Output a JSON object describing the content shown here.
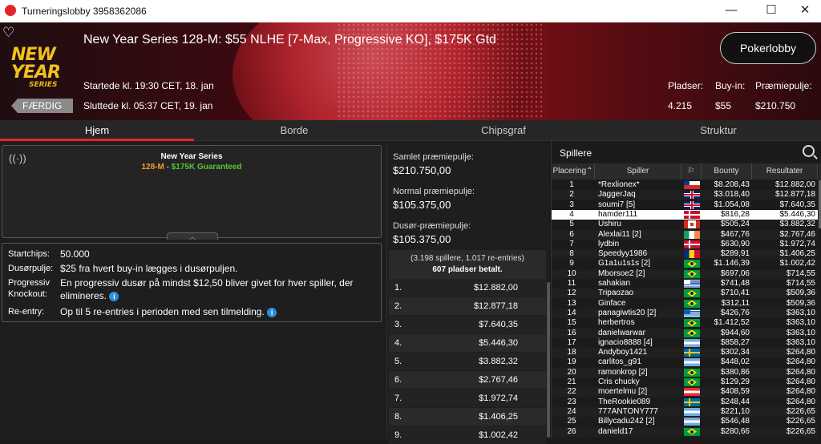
{
  "window": {
    "title": "Turneringslobby 3958362086",
    "minimize": "—",
    "maximize": "☐",
    "close": "✕"
  },
  "header": {
    "logo_line1": "NEW YEAR",
    "logo_line2": "SERIES",
    "status": "FÆRDIG",
    "title": "New Year Series 128-M: $55 NLHE [7-Max, Progressive KO], $175K Gtd",
    "started": "Startede kl. 19:30 CET, 18. jan",
    "ended": "Sluttede kl. 05:37 CET, 19. jan",
    "lobby_button": "Pokerlobby",
    "stats": [
      {
        "label": "Pladser:",
        "value": "4.215"
      },
      {
        "label": "Buy-in:",
        "value": "$55"
      },
      {
        "label": "Præmiepulje:",
        "value": "$210.750"
      }
    ]
  },
  "tabs": [
    "Hjem",
    "Borde",
    "Chipsgraf",
    "Struktur"
  ],
  "info": {
    "name": "New Year Series",
    "code": "128-M",
    "separator": " - ",
    "guarantee": "$175K Guaranteed"
  },
  "details": {
    "startchips_label": "Startchips:",
    "startchips": "50.000",
    "dusorpulje_label": "Dusørpulje:",
    "dusorpulje": "$25 fra hvert buy-in lægges i dusørpuljen.",
    "progressive_label1": "Progressiv",
    "progressive_label2": "Knockout:",
    "progressive": "En progressiv dusør på mindst $12,50 bliver givet for hver spiller, der elimineres.",
    "reentry_label": "Re-entry:",
    "reentry": "Op til 5 re-entries i perioden med sen tilmelding."
  },
  "prizes": {
    "total_label": "Samlet præmiepulje:",
    "total": "$210.750,00",
    "normal_label": "Normal præmiepulje:",
    "normal": "$105.375,00",
    "bounty_label": "Dusør-præmiepulje:",
    "bounty": "$105.375,00",
    "entries": "(3.198 spillere, 1.017 re-entries)",
    "paid": "607 pladser betalt.",
    "payouts": [
      {
        "rank": "1.",
        "amount": "$12.882,00"
      },
      {
        "rank": "2.",
        "amount": "$12.877,18"
      },
      {
        "rank": "3.",
        "amount": "$7.640,35"
      },
      {
        "rank": "4.",
        "amount": "$5.446,30"
      },
      {
        "rank": "5.",
        "amount": "$3.882,32"
      },
      {
        "rank": "6.",
        "amount": "$2.767,46"
      },
      {
        "rank": "7.",
        "amount": "$1.972,74"
      },
      {
        "rank": "8.",
        "amount": "$1.406,25"
      },
      {
        "rank": "9.",
        "amount": "$1.002,42"
      }
    ]
  },
  "players": {
    "title": "Spillere",
    "columns": {
      "rank": "Placering",
      "player": "Spiller",
      "bounty": "Bounty",
      "result": "Resultater"
    },
    "rows": [
      {
        "rank": "1",
        "name": "*Rexlionex*",
        "flag": "cl",
        "bounty": "$8.208,43",
        "result": "$12.882,00"
      },
      {
        "rank": "2",
        "name": "JaggerJaq",
        "flag": "gb",
        "bounty": "$3.018,40",
        "result": "$12.877,18"
      },
      {
        "rank": "3",
        "name": "soumi7 [5]",
        "flag": "gb",
        "bounty": "$1.054,08",
        "result": "$7.640,35"
      },
      {
        "rank": "4",
        "name": "hamder111",
        "flag": "dk",
        "bounty": "$816,28",
        "result": "$5.446,30"
      },
      {
        "rank": "5",
        "name": "Ushiru",
        "flag": "ca",
        "bounty": "$505,24",
        "result": "$3.882,32"
      },
      {
        "rank": "6",
        "name": "Alexlai11 [2]",
        "flag": "ie",
        "bounty": "$467,76",
        "result": "$2.767,46"
      },
      {
        "rank": "7",
        "name": "lydbin",
        "flag": "dk",
        "bounty": "$630,90",
        "result": "$1.972,74"
      },
      {
        "rank": "8",
        "name": "Speedyy1986",
        "flag": "ro",
        "bounty": "$289,91",
        "result": "$1.406,25"
      },
      {
        "rank": "9",
        "name": "G1a1u1s1s [2]",
        "flag": "br",
        "bounty": "$1.146,39",
        "result": "$1.002,42"
      },
      {
        "rank": "10",
        "name": "Mborsoe2 [2]",
        "flag": "br",
        "bounty": "$697,06",
        "result": "$714,55"
      },
      {
        "rank": "11",
        "name": "sahakian",
        "flag": "uy",
        "bounty": "$741,48",
        "result": "$714,55"
      },
      {
        "rank": "12",
        "name": "Tripaozao",
        "flag": "br",
        "bounty": "$710,41",
        "result": "$509,36"
      },
      {
        "rank": "13",
        "name": "Ginface",
        "flag": "br",
        "bounty": "$312,11",
        "result": "$509,36"
      },
      {
        "rank": "14",
        "name": "panagiwtis20 [2]",
        "flag": "gr",
        "bounty": "$426,76",
        "result": "$363,10"
      },
      {
        "rank": "15",
        "name": "herbertros",
        "flag": "br",
        "bounty": "$1.412,52",
        "result": "$363,10"
      },
      {
        "rank": "16",
        "name": "danielwarwar",
        "flag": "br",
        "bounty": "$944,60",
        "result": "$363,10"
      },
      {
        "rank": "17",
        "name": "ignacio8888 [4]",
        "flag": "ar",
        "bounty": "$858,27",
        "result": "$363,10"
      },
      {
        "rank": "18",
        "name": "Andyboy1421",
        "flag": "se",
        "bounty": "$302,34",
        "result": "$264,80"
      },
      {
        "rank": "19",
        "name": "carlitos_g91",
        "flag": "ar",
        "bounty": "$448,02",
        "result": "$264,80"
      },
      {
        "rank": "20",
        "name": "ramonkrop [2]",
        "flag": "br",
        "bounty": "$380,86",
        "result": "$264,80"
      },
      {
        "rank": "21",
        "name": "Cris chucky",
        "flag": "br",
        "bounty": "$129,29",
        "result": "$264,80"
      },
      {
        "rank": "22",
        "name": "moertelmu [2]",
        "flag": "at",
        "bounty": "$408,59",
        "result": "$264,80"
      },
      {
        "rank": "23",
        "name": "TheRookie089",
        "flag": "se",
        "bounty": "$248,44",
        "result": "$264,80"
      },
      {
        "rank": "24",
        "name": "777ANTONY777",
        "flag": "ar",
        "bounty": "$221,10",
        "result": "$226,65"
      },
      {
        "rank": "25",
        "name": "Billycadu242 [2]",
        "flag": "ar",
        "bounty": "$546,48",
        "result": "$226,65"
      },
      {
        "rank": "26",
        "name": "danield17",
        "flag": "br",
        "bounty": "$280,66",
        "result": "$226,65"
      }
    ]
  }
}
